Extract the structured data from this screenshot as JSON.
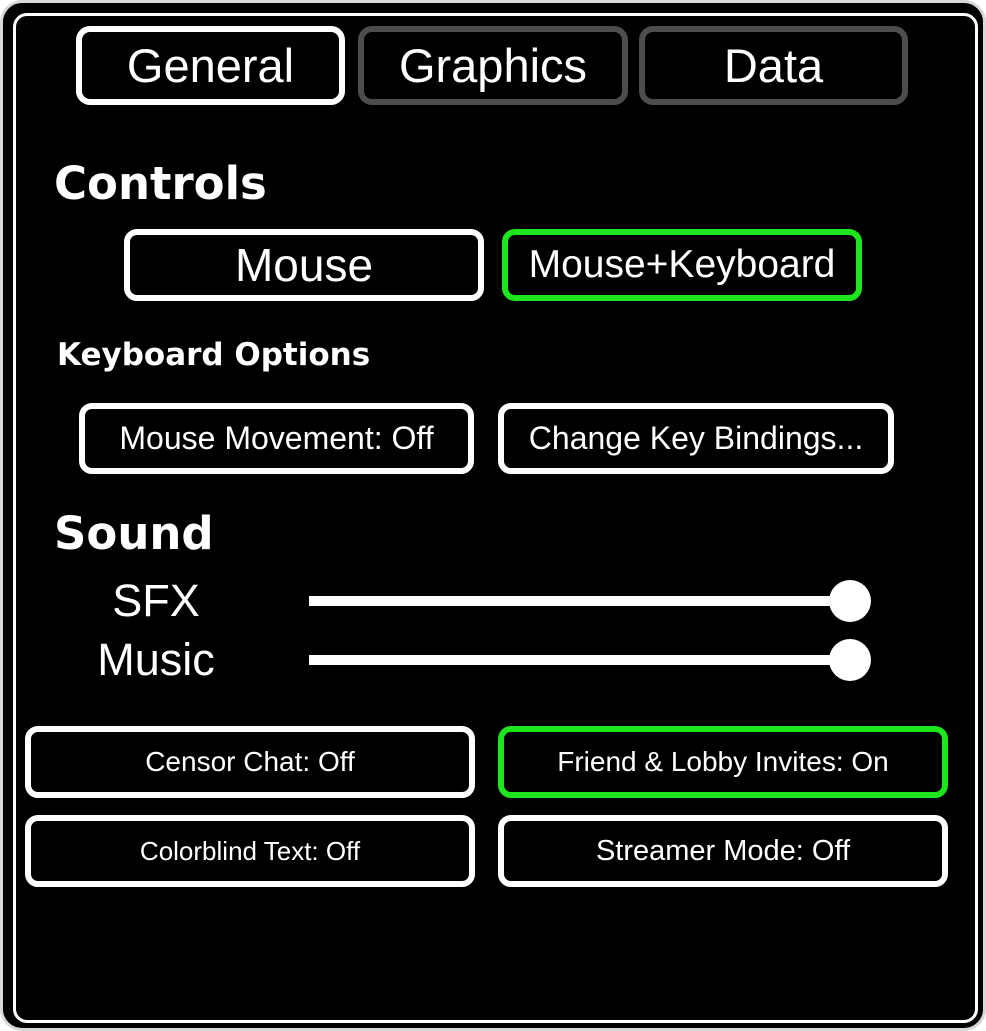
{
  "tabs": [
    {
      "label": "General",
      "active": true
    },
    {
      "label": "Graphics",
      "active": false
    },
    {
      "label": "Data",
      "active": false
    }
  ],
  "controls": {
    "heading": "Controls",
    "mouse_label": "Mouse",
    "mouse_keyboard_label": "Mouse+Keyboard",
    "selected": "Mouse+Keyboard"
  },
  "keyboard_options": {
    "heading": "Keyboard Options",
    "mouse_movement_label": "Mouse Movement: Off",
    "key_bindings_label": "Change Key Bindings..."
  },
  "sound": {
    "heading": "Sound",
    "sliders": [
      {
        "label": "SFX",
        "value_fraction": 1.0
      },
      {
        "label": "Music",
        "value_fraction": 1.0
      }
    ]
  },
  "toggles": {
    "censor_chat": "Censor Chat: Off",
    "friend_invites": "Friend & Lobby Invites: On",
    "colorblind_text": "Colorblind Text: Off",
    "streamer_mode": "Streamer Mode: Off"
  },
  "colors": {
    "background": "#000000",
    "border_default": "#ffffff",
    "border_inactive_tab": "#4d4d4d",
    "accent_selected": "#1ee61e"
  }
}
